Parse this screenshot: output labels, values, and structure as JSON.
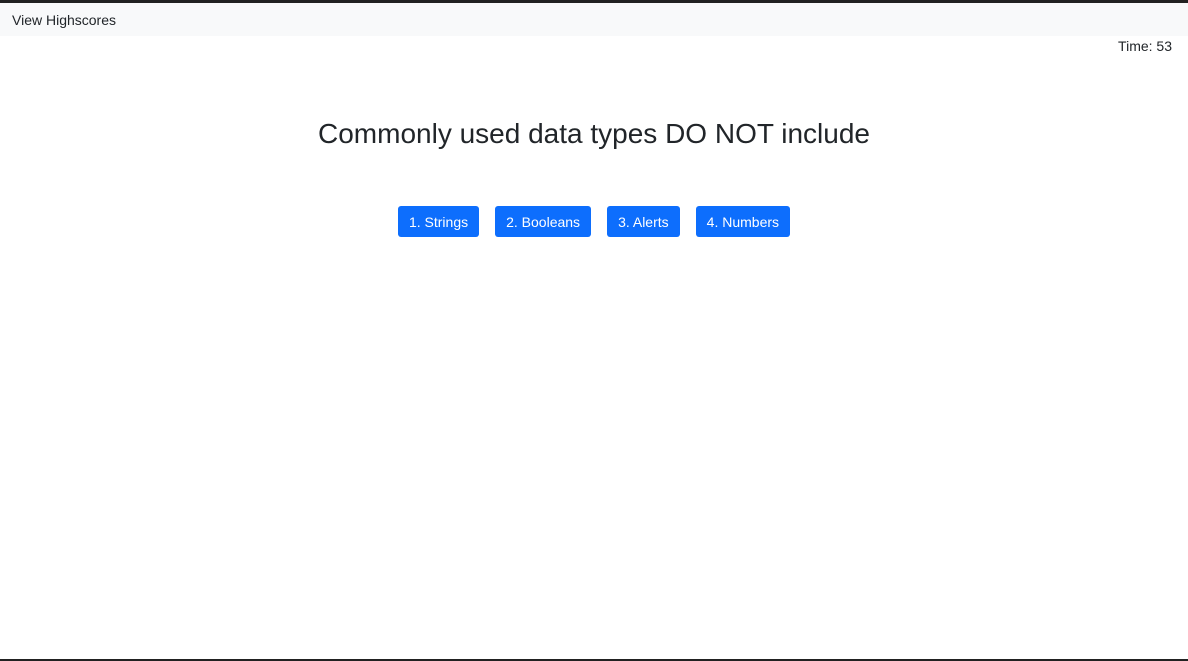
{
  "nav": {
    "highscores_link": "View Highscores"
  },
  "timer": {
    "label": "Time:",
    "value": "53"
  },
  "quiz": {
    "question": "Commonly used data types DO NOT include",
    "answers": [
      "1. Strings",
      "2. Booleans",
      "3. Alerts",
      "4. Numbers"
    ]
  },
  "colors": {
    "button_bg": "#0d6efd",
    "navbar_bg": "#f8f9fa"
  }
}
